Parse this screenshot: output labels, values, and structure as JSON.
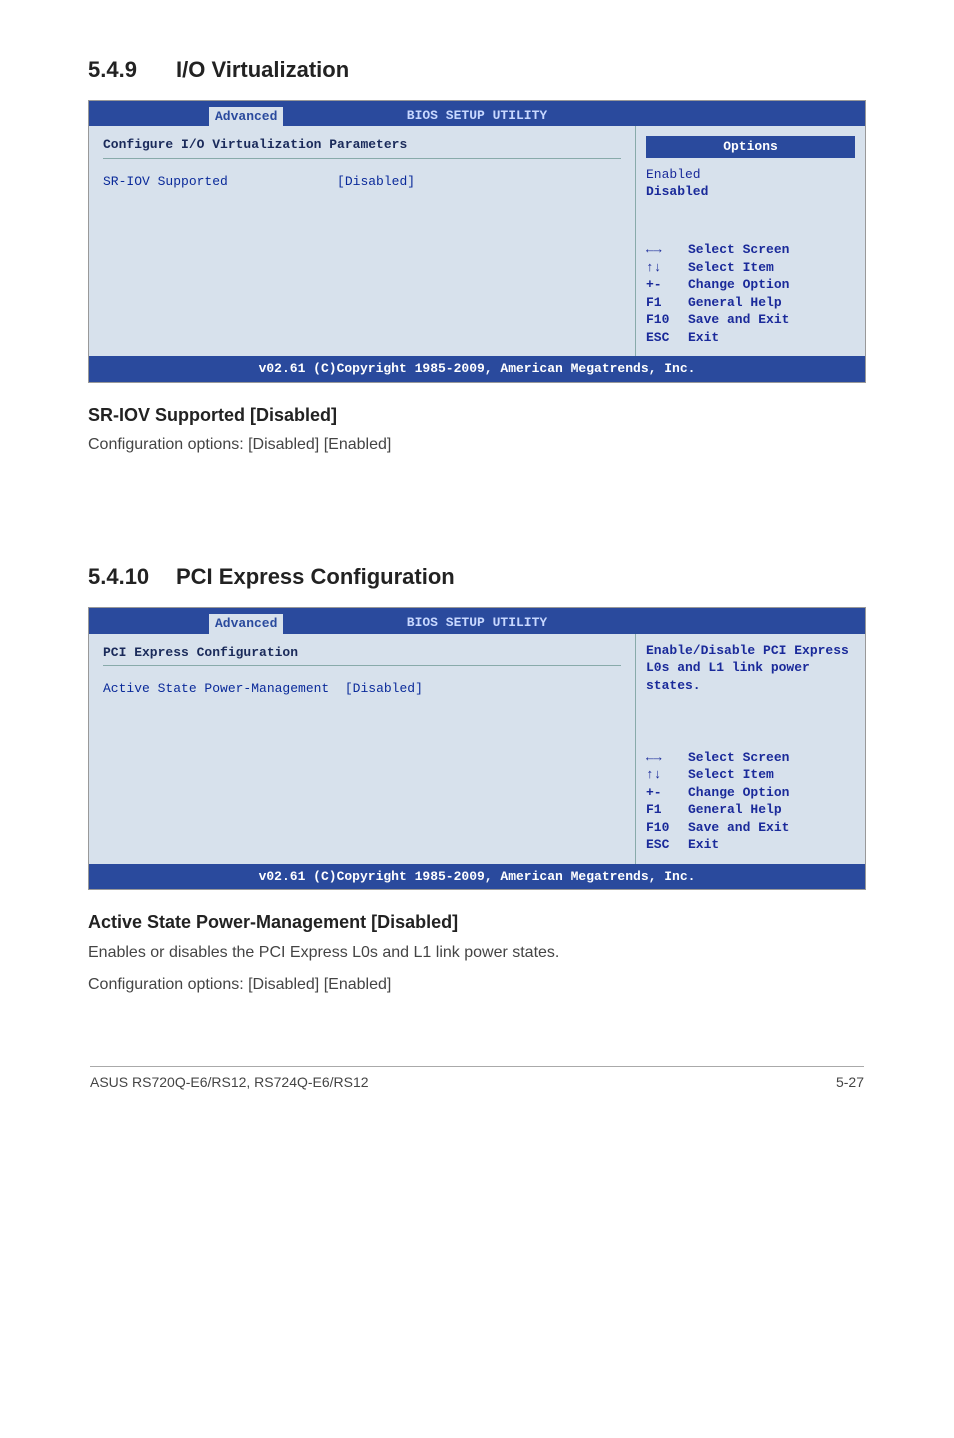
{
  "section1": {
    "num": "5.4.9",
    "title": "I/O Virtualization",
    "bios": {
      "util_title": "BIOS SETUP UTILITY",
      "tab": "Advanced",
      "panel_title": "Configure I/O Virtualization Parameters",
      "item_label": "SR-IOV Supported",
      "item_value": "[Disabled]",
      "options_header": "Options",
      "options": [
        "Enabled",
        "Disabled"
      ],
      "help": [
        {
          "key": "←→",
          "text": "Select Screen"
        },
        {
          "key": "↑↓",
          "text": "Select Item"
        },
        {
          "key": "+-",
          "text": "Change Option"
        },
        {
          "key": "F1",
          "text": "General Help"
        },
        {
          "key": "F10",
          "text": "Save and Exit"
        },
        {
          "key": "ESC",
          "text": "Exit"
        }
      ],
      "footer": "v02.61 (C)Copyright 1985-2009, American Megatrends, Inc."
    },
    "sub_heading": "SR-IOV Supported [Disabled]",
    "sub_text": "Configuration options: [Disabled] [Enabled]"
  },
  "section2": {
    "num": "5.4.10",
    "title": "PCI Express Configuration",
    "bios": {
      "util_title": "BIOS SETUP UTILITY",
      "tab": "Advanced",
      "panel_title": "PCI Express Configuration",
      "item_label": "Active State Power-Management",
      "item_value": "[Disabled]",
      "desc": "Enable/Disable PCI Express L0s and L1 link power states.",
      "help": [
        {
          "key": "←→",
          "text": "Select Screen"
        },
        {
          "key": "↑↓",
          "text": "Select Item"
        },
        {
          "key": "+-",
          "text": "Change Option"
        },
        {
          "key": "F1",
          "text": "General Help"
        },
        {
          "key": "F10",
          "text": "Save and Exit"
        },
        {
          "key": "ESC",
          "text": "Exit"
        }
      ],
      "footer": "v02.61 (C)Copyright 1985-2009, American Megatrends, Inc."
    },
    "sub_heading": "Active State Power-Management [Disabled]",
    "sub_text1": "Enables or disables the PCI Express L0s and L1 link power states.",
    "sub_text2": "Configuration options: [Disabled] [Enabled]"
  },
  "footer": {
    "left": "ASUS RS720Q-E6/RS12, RS724Q-E6/RS12",
    "right": "5-27"
  }
}
